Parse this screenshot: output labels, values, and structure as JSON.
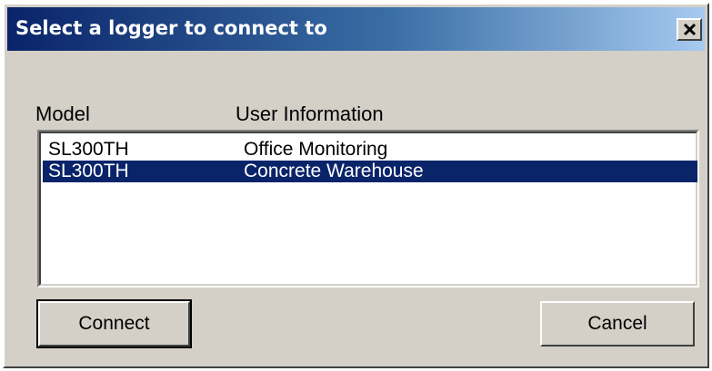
{
  "window": {
    "title": "Select a logger to connect to",
    "close_glyph": "close-icon"
  },
  "list": {
    "columns": [
      "Model",
      "User Information"
    ],
    "rows": [
      {
        "model": "SL300TH",
        "info": "Office Monitoring",
        "selected": false
      },
      {
        "model": "SL300TH",
        "info": "Concrete Warehouse",
        "selected": true
      }
    ]
  },
  "buttons": {
    "connect": "Connect",
    "cancel": "Cancel"
  },
  "colors": {
    "dialog_face": "#d4d0c8",
    "selection": "#0a246a",
    "title_gradient_start": "#0a246a",
    "title_gradient_end": "#a6caf0"
  }
}
